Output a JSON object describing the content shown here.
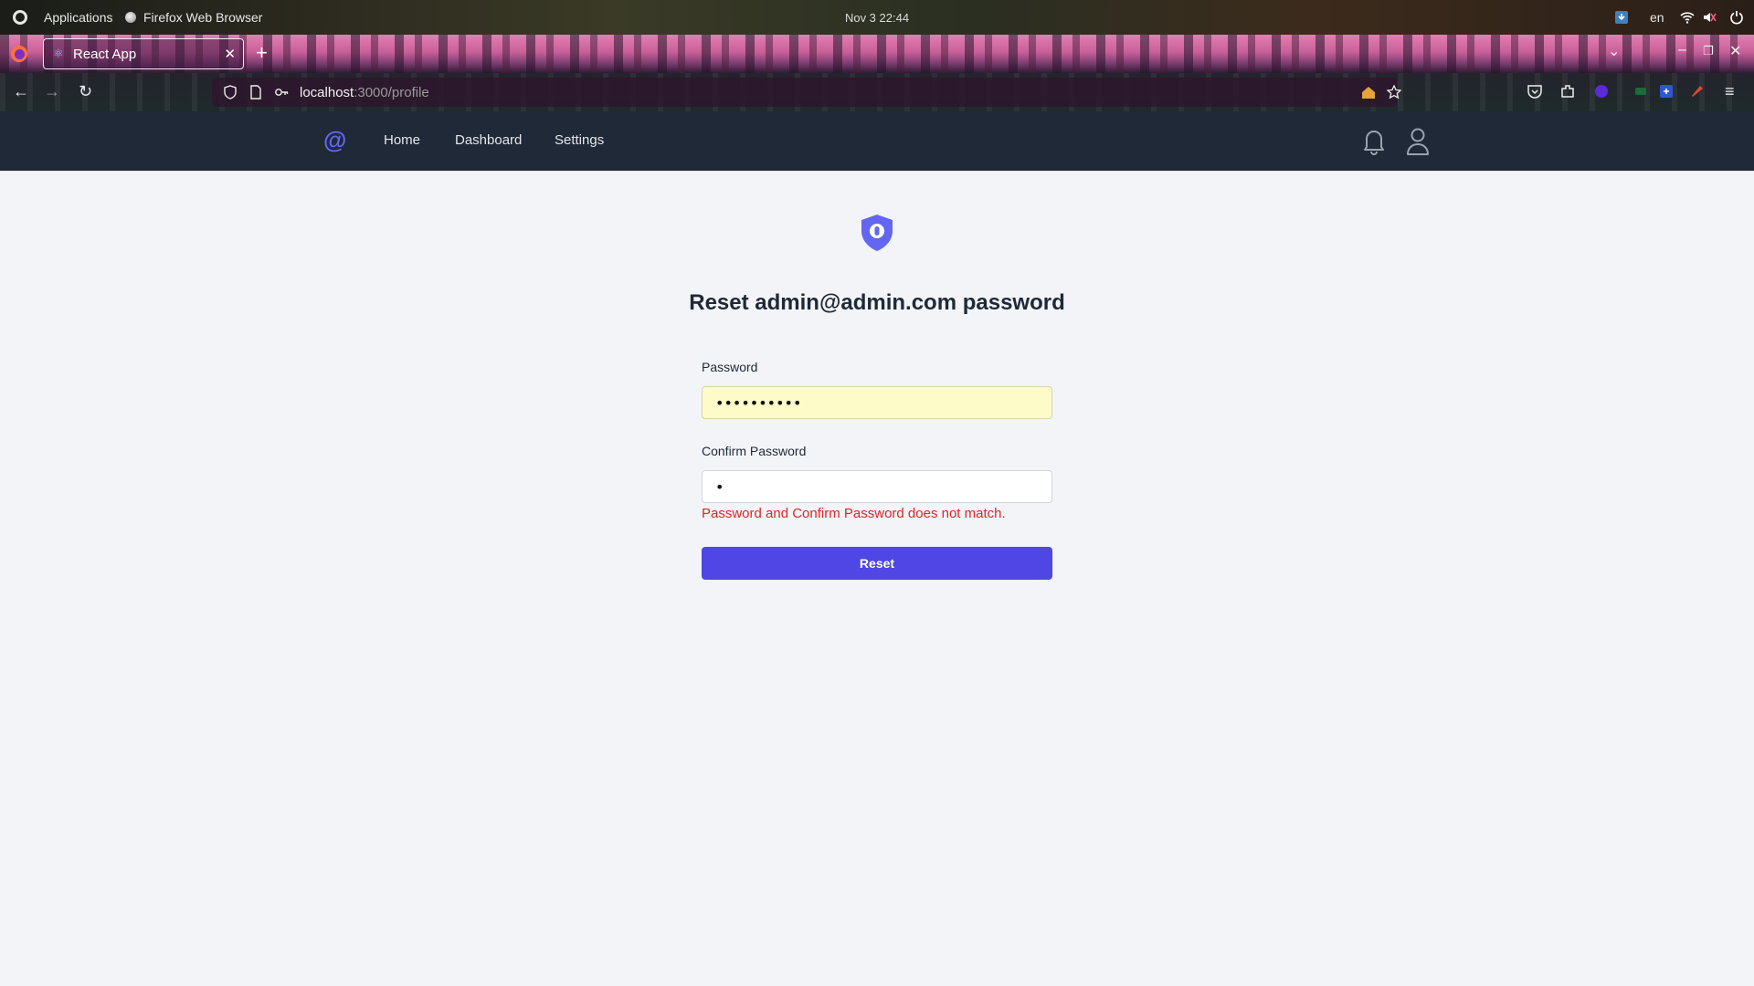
{
  "os": {
    "applications_label": "Applications",
    "browser_label": "Firefox Web Browser",
    "clock": "Nov 3  22:44",
    "language": "en"
  },
  "browser": {
    "tab_title": "React App",
    "url_host": "localhost",
    "url_path": ":3000/profile"
  },
  "app": {
    "logo_glyph": "@",
    "nav_links": [
      "Home",
      "Dashboard",
      "Settings"
    ]
  },
  "form": {
    "title": "Reset admin@admin.com password",
    "password_label": "Password",
    "password_value": "••••••••••",
    "confirm_label": "Confirm Password",
    "confirm_value": "•",
    "error": "Password and Confirm Password does not match.",
    "submit_label": "Reset"
  },
  "colors": {
    "accent": "#4f46e5",
    "logo": "#6366f1",
    "error": "#dc2626",
    "navbar": "#1f2937",
    "background": "#f2f4f8",
    "autofill": "#fdfbc8"
  },
  "icons": {
    "shield": "shield-lock-icon",
    "bell": "bell-icon",
    "user": "user-icon"
  }
}
